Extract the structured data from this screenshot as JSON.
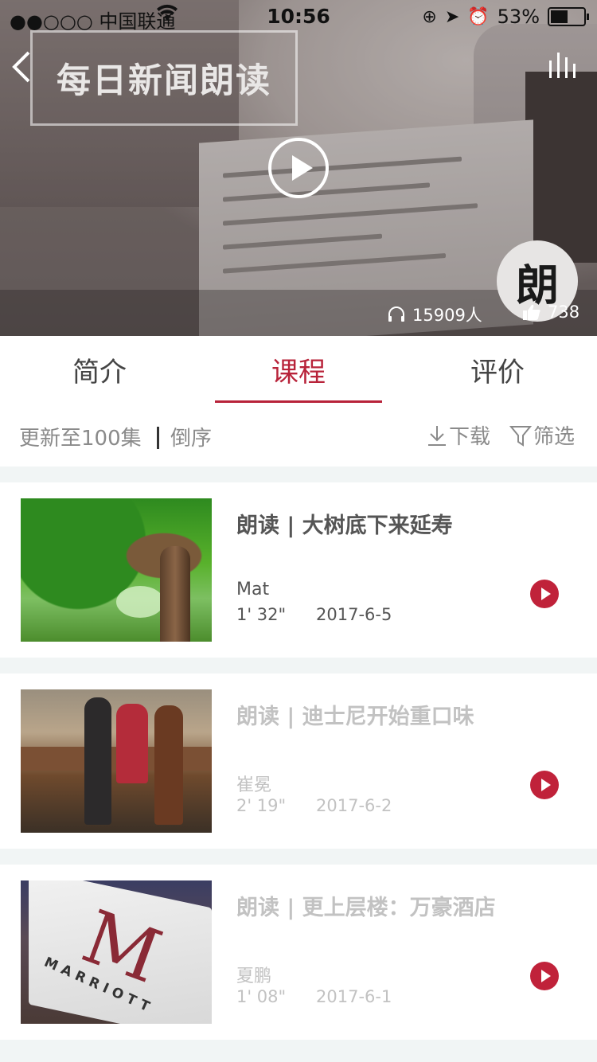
{
  "status_bar": {
    "carrier": "●●○○○ 中国联通",
    "time": "10:56",
    "battery": "53%",
    "battery_level": 0.53
  },
  "header": {
    "title": "每日新闻朗读",
    "avatar_text": "朗",
    "listeners": "15909人",
    "likes": "738"
  },
  "tabs": [
    {
      "label": "简介",
      "active": false
    },
    {
      "label": "课程",
      "active": true
    },
    {
      "label": "评价",
      "active": false
    }
  ],
  "toolbar": {
    "update": "更新至100集",
    "order": "倒序",
    "download": "下载",
    "filter": "筛选"
  },
  "episodes": [
    {
      "title": "朗读 | 大树底下来延寿",
      "author": "Mat",
      "duration": "1' 32\"",
      "date": "2017-6-5",
      "played": false
    },
    {
      "title": "朗读 | 迪士尼开始重口味",
      "author": "崔冕",
      "duration": "2' 19\"",
      "date": "2017-6-2",
      "played": true
    },
    {
      "title": "朗读 | 更上层楼：万豪酒店",
      "author": "夏鹏",
      "duration": "1' 08\"",
      "date": "2017-6-1",
      "played": true
    }
  ],
  "thumbnail_text": {
    "marriott_word": "MARRIOTT",
    "marriott_letter": "M"
  },
  "colors": {
    "accent": "#b8233a",
    "play_button": "#c0223a"
  }
}
